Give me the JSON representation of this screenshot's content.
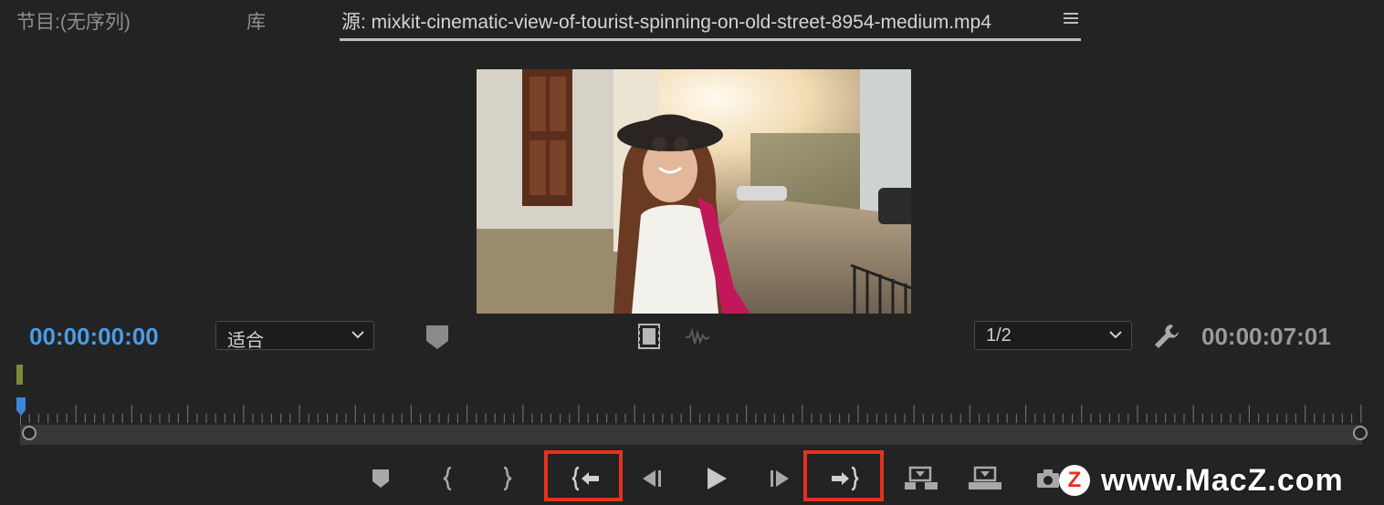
{
  "tabs": [
    {
      "label": "节目:(无序列)",
      "active": false
    },
    {
      "label": "库",
      "active": false
    },
    {
      "label": "源: mixkit-cinematic-view-of-tourist-spinning-on-old-street-8954-medium.mp4",
      "active": true
    }
  ],
  "panel_menu_icon": "hamburger-menu-icon",
  "preview": {
    "description_icon": "video-frame-thumbnail"
  },
  "controls": {
    "current_timecode": "00:00:00:00",
    "zoom_select": {
      "value": "适合"
    },
    "resolution_select": {
      "value": "1/2"
    },
    "duration_timecode": "00:00:07:01",
    "timecode_color": "#4a9be6"
  },
  "transport_buttons": [
    {
      "name": "add-marker-button",
      "icon": "marker-icon"
    },
    {
      "name": "mark-in-button",
      "icon": "mark-in-icon"
    },
    {
      "name": "mark-out-button",
      "icon": "mark-out-icon"
    },
    {
      "name": "go-to-in-button",
      "icon": "go-to-in-icon",
      "highlighted": true
    },
    {
      "name": "step-back-button",
      "icon": "step-back-icon"
    },
    {
      "name": "play-button",
      "icon": "play-icon"
    },
    {
      "name": "step-forward-button",
      "icon": "step-forward-icon"
    },
    {
      "name": "go-to-out-button",
      "icon": "go-to-out-icon",
      "highlighted": true
    },
    {
      "name": "insert-button",
      "icon": "insert-icon"
    },
    {
      "name": "overwrite-button",
      "icon": "overwrite-icon"
    },
    {
      "name": "export-frame-button",
      "icon": "camera-icon"
    }
  ],
  "highlight_color": "#e4321f",
  "watermark": {
    "badge": "Z",
    "text": "www.MacZ.com"
  }
}
